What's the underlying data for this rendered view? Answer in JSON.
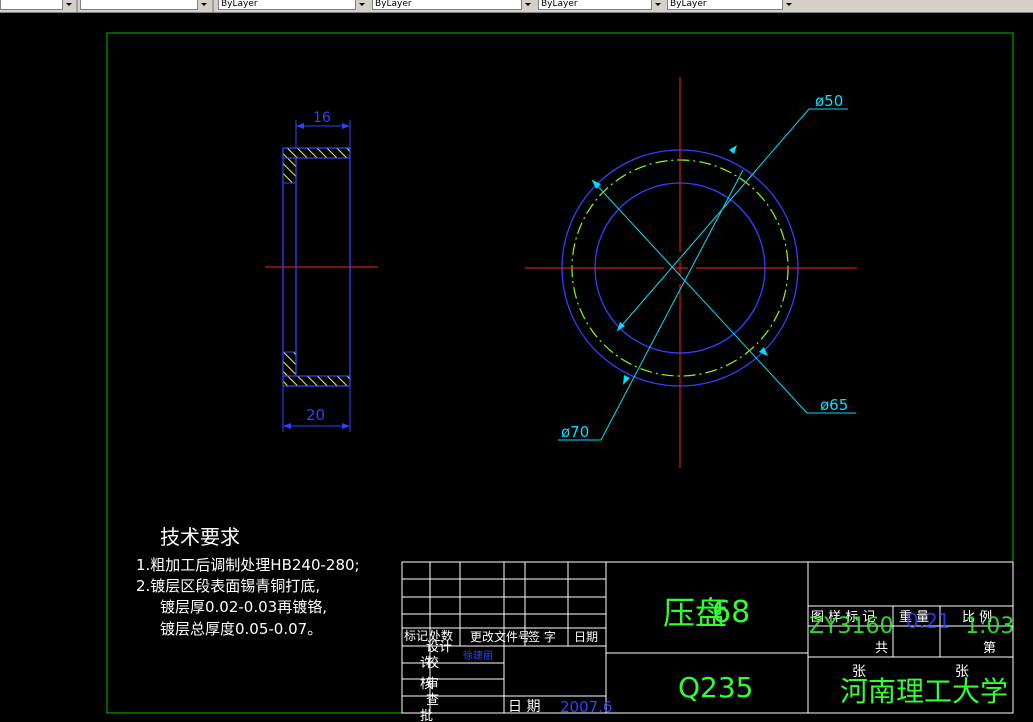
{
  "toolbar": {
    "layer_dropdown": "",
    "style_dropdown": "",
    "color_dropdown": "ByLayer",
    "linetype_dropdown": "ByLayer",
    "lineweight_dropdown": "ByLayer",
    "plotstyle_dropdown": "ByLayer"
  },
  "colors": {
    "frame": "#00c000",
    "dimension": "#00e0ff",
    "outline": "#3040ff",
    "centerline": "#ff2020",
    "hidden_circle": "#90ff00",
    "text": "#ffffff",
    "title_green": "#30ff30"
  },
  "drawing": {
    "side_view": {
      "dim_top": "16",
      "dim_bottom": "20"
    },
    "front_view": {
      "dia_50": "ø50",
      "dia_65": "ø65",
      "dia_70": "ø70"
    },
    "notes": {
      "heading": "技术要求",
      "line1": "1.粗加工后调制处理HB240-280;",
      "line2": "2.镀层区段表面锡青铜打底,",
      "line3": "镀层厚0.02-0.03再镀铬,",
      "line4": "镀层总厚度0.05-0.07。"
    }
  },
  "title_block": {
    "part_name": "压盘",
    "part_number": "68",
    "material": "Q235",
    "school": "河南理工大学",
    "hdr_mark": "标记",
    "hdr_count": "处数",
    "hdr_change_doc": "更改文件号",
    "hdr_sign": "签 字",
    "hdr_date": "日期",
    "row_design": "设计",
    "row_proofread": "校",
    "row_drafter": "许",
    "row_review": "审",
    "row_check": "核",
    "row_audit": "查",
    "row_approve": "批",
    "designer_name": "徐建丽",
    "date_label": "日 期",
    "date_value": "2007.6",
    "hdr_drawing": "图 样 标 记",
    "hdr_weight": "重 量",
    "hdr_scale": "比 例",
    "drawing_code": "ZY3160",
    "weight_value": "0.21",
    "scale_value": "1:03",
    "total_label": "共",
    "sheet_label": "第",
    "zhang_1": "张",
    "zhang_2": "张"
  }
}
